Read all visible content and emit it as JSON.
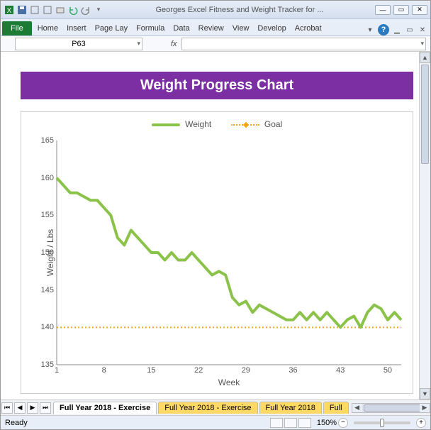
{
  "window": {
    "title": "Georges Excel Fitness and Weight Tracker for ...",
    "min_label": "—",
    "max_label": "▭",
    "close_label": "✕"
  },
  "ribbon": {
    "file": "File",
    "tabs": [
      "Home",
      "Insert",
      "Page Lay",
      "Formula",
      "Data",
      "Review",
      "View",
      "Develop",
      "Acrobat"
    ],
    "overflow": "▾"
  },
  "namebox": {
    "value": "P63"
  },
  "formula": {
    "label": "fx",
    "value": ""
  },
  "chart_title": "Weight Progress Chart",
  "legend": {
    "series_a": "Weight",
    "series_b": "Goal"
  },
  "axes": {
    "ylabel": "Weight / Lbs",
    "xlabel": "Week",
    "yticks": [
      135,
      140,
      145,
      150,
      155,
      160,
      165
    ],
    "xticks": [
      1,
      8,
      15,
      22,
      29,
      36,
      43,
      50
    ],
    "xmin": 1,
    "xmax": 52,
    "ymin": 135,
    "ymax": 165
  },
  "chart_data": {
    "type": "line",
    "title": "Weight Progress Chart",
    "xlabel": "Week",
    "ylabel": "Weight / Lbs",
    "xlim": [
      1,
      52
    ],
    "ylim": [
      135,
      165
    ],
    "x": [
      1,
      2,
      3,
      4,
      5,
      6,
      7,
      8,
      9,
      10,
      11,
      12,
      13,
      14,
      15,
      16,
      17,
      18,
      19,
      20,
      21,
      22,
      23,
      24,
      25,
      26,
      27,
      28,
      29,
      30,
      31,
      32,
      33,
      34,
      35,
      36,
      37,
      38,
      39,
      40,
      41,
      42,
      43,
      44,
      45,
      46,
      47,
      48,
      49,
      50,
      51,
      52
    ],
    "series": [
      {
        "name": "Weight",
        "color": "#8bc34a",
        "values": [
          160,
          159,
          158,
          158,
          157.5,
          157,
          157,
          156,
          155,
          152,
          151,
          153,
          152,
          151,
          150,
          150,
          149,
          150,
          149,
          149,
          150,
          149,
          148,
          147,
          147.5,
          147,
          144,
          143,
          143.5,
          142,
          143,
          142.5,
          142,
          141.5,
          141,
          141,
          142,
          141,
          142,
          141,
          142,
          141,
          140,
          141,
          141.5,
          140,
          142,
          143,
          142.5,
          141,
          142,
          141
        ]
      },
      {
        "name": "Goal",
        "color": "#f5a623",
        "values": [
          140,
          140,
          140,
          140,
          140,
          140,
          140,
          140,
          140,
          140,
          140,
          140,
          140,
          140,
          140,
          140,
          140,
          140,
          140,
          140,
          140,
          140,
          140,
          140,
          140,
          140,
          140,
          140,
          140,
          140,
          140,
          140,
          140,
          140,
          140,
          140,
          140,
          140,
          140,
          140,
          140,
          140,
          140,
          140,
          140,
          140,
          140,
          140,
          140,
          140,
          140,
          140
        ]
      }
    ]
  },
  "sheets": {
    "nav": [
      "⏮",
      "◀",
      "▶",
      "⏭"
    ],
    "tabs": [
      "Full Year 2018 - Exercise",
      "Full Year 2018 - Exercise",
      "Full Year 2018",
      "Full"
    ]
  },
  "status": {
    "ready": "Ready",
    "zoom": "150%",
    "minus": "−",
    "plus": "+"
  }
}
